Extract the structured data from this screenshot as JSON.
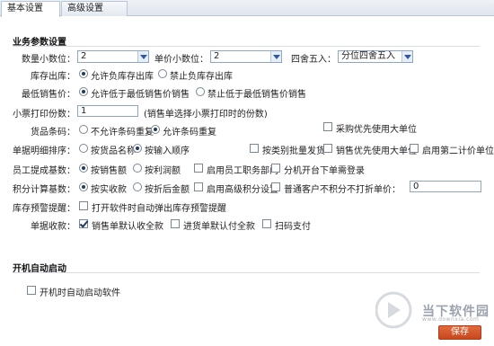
{
  "tabs": [
    {
      "label": "基本设置",
      "active": true
    },
    {
      "label": "高级设置",
      "active": false
    }
  ],
  "business": {
    "title": "业务参数设置",
    "qty_decimal": {
      "label": "数量小数位：",
      "value": "2"
    },
    "price_decimal": {
      "label": "单价小数位：",
      "value": "2"
    },
    "rounding": {
      "label": "四舍五入：",
      "value": "分位四舍五入"
    },
    "stock_out": {
      "label": "库存出库：",
      "opt1": "允许负库存出库",
      "opt2": "禁止负库存出库",
      "selected": 1
    },
    "min_price": {
      "label": "最低销售价：",
      "opt1": "允许低于最低销售价销售",
      "opt2": "禁止低于最低销售价销售",
      "selected": 1
    },
    "receipt_copies": {
      "label": "小票打印份数：",
      "value": "1",
      "hint": "(销售单选择小票打印时的份数)"
    },
    "barcode": {
      "label": "货品条码：",
      "opt1": "不允许条码重复",
      "opt2": "允许条码重复",
      "selected": 2,
      "check": "采购优先使用大单位",
      "check_on": false
    },
    "detail_sort": {
      "label": "单据明细排序：",
      "opt1": "按货品名称",
      "opt2": "按输入顺序",
      "selected": 2,
      "check1": "按类别批量发货",
      "check2": "销售优先使用大单位",
      "check3": "启用第二计价单位"
    },
    "commission": {
      "label": "员工提成基数：",
      "opt1": "按销售额",
      "opt2": "按利润额",
      "selected": 1,
      "check1": "启用员工职务部门",
      "check2": "分机开台下单需登录"
    },
    "points": {
      "label": "积分计算基数：",
      "opt1": "按实收款",
      "opt2": "按折后金额",
      "selected": 1,
      "check1": "启用高级积分设置",
      "check2": "普通客户不积分",
      "unit_label": "不打折单价：",
      "unit_value": "0"
    },
    "stock_alert": {
      "label": "库存预警提醒：",
      "check": "打开软件时自动弹出库存预警提醒"
    },
    "receipt_money": {
      "label": "单据收款：",
      "check1": "销售单默认收全款",
      "check1_on": true,
      "check2": "进货单默认付全款",
      "check3": "扫码支付"
    }
  },
  "startup": {
    "title": "开机自动启动",
    "check": "开机时自动启动软件"
  },
  "watermark": {
    "text": "当下软件园",
    "sub": "www.downxia.com"
  },
  "save_label": "保存"
}
